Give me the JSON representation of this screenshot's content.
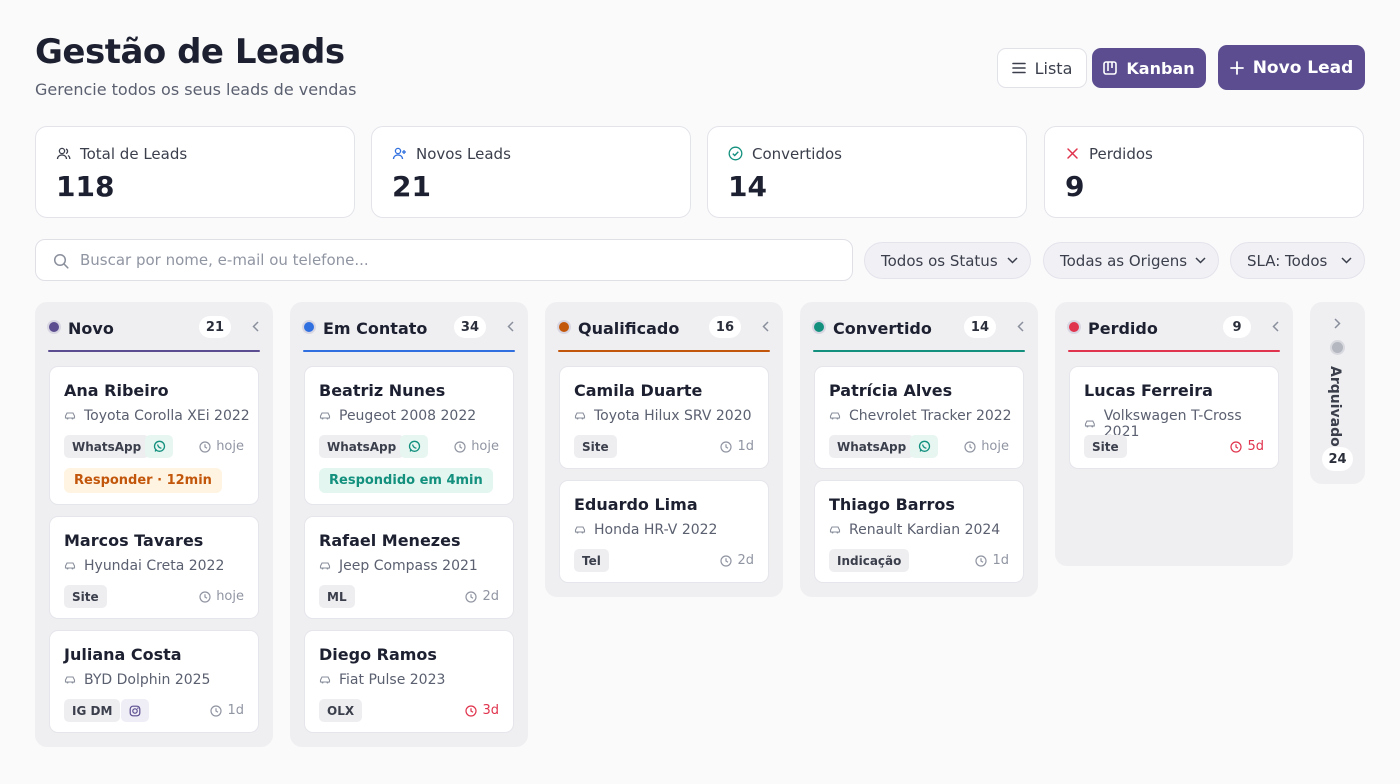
{
  "header": {
    "title": "Gestão de Leads",
    "subtitle": "Gerencie todos os seus leads de vendas",
    "view_list": "Lista",
    "view_kanban": "Kanban",
    "new_lead": "Novo Lead"
  },
  "stats": [
    {
      "label": "Total de Leads",
      "value": "118",
      "icon": "users-icon"
    },
    {
      "label": "Novos Leads",
      "value": "21",
      "icon": "user-plus-icon"
    },
    {
      "label": "Convertidos",
      "value": "14",
      "icon": "check-circle-icon"
    },
    {
      "label": "Perdidos",
      "value": "9",
      "icon": "x-icon"
    }
  ],
  "search": {
    "placeholder": "Buscar por nome, e-mail ou telefone..."
  },
  "filters": {
    "status": "Todos os Status",
    "origin": "Todas as Origens",
    "sla": "SLA: Todos"
  },
  "columns": [
    {
      "name": "Novo",
      "count": "21",
      "color": "#5b4d8f",
      "cards": [
        {
          "name": "Ana Ribeiro",
          "car": "Toyota Corolla XEi 2022",
          "tag": "WhatsApp",
          "icon": "whatsapp",
          "time": "hoje",
          "sla": "Responder · 12min"
        },
        {
          "name": "Marcos Tavares",
          "car": "Hyundai Creta 2022",
          "tag": "Site",
          "time": "hoje"
        },
        {
          "name": "Juliana Costa",
          "car": "BYD Dolphin 2025",
          "tag": "IG DM",
          "icon": "instagram",
          "time": "1d"
        }
      ]
    },
    {
      "name": "Em Contato",
      "count": "34",
      "color": "#2f6fe0",
      "cards": [
        {
          "name": "Beatriz Nunes",
          "car": "Peugeot 2008 2022",
          "tag": "WhatsApp",
          "icon": "whatsapp",
          "time": "hoje",
          "sla": "Respondido em 4min"
        },
        {
          "name": "Rafael Menezes",
          "car": "Jeep Compass 2021",
          "tag": "ML",
          "time": "2d"
        },
        {
          "name": "Diego Ramos",
          "car": "Fiat Pulse 2023",
          "tag": "OLX",
          "time": "3d",
          "late": true
        }
      ]
    },
    {
      "name": "Qualificado",
      "count": "16",
      "color": "#c2570c",
      "cards": [
        {
          "name": "Camila Duarte",
          "car": "Toyota Hilux SRV 2020",
          "tag": "Site",
          "time": "1d"
        },
        {
          "name": "Eduardo Lima",
          "car": "Honda HR-V 2022",
          "tag": "Tel",
          "time": "2d"
        }
      ]
    },
    {
      "name": "Convertido",
      "count": "14",
      "color": "#13907e",
      "cards": [
        {
          "name": "Patrícia Alves",
          "car": "Chevrolet Tracker 2022",
          "tag": "WhatsApp",
          "icon": "whatsapp",
          "time": "hoje"
        },
        {
          "name": "Thiago Barros",
          "car": "Renault Kardian 2024",
          "tag": "Indicação",
          "time": "1d"
        }
      ]
    },
    {
      "name": "Perdido",
      "count": "9",
      "color": "#e0334d",
      "cards": [
        {
          "name": "Lucas Ferreira",
          "car": "Volkswagen T-Cross 2021",
          "tag": "Site",
          "time": "5d",
          "late": true
        }
      ]
    }
  ],
  "archived": {
    "label": "Arquivado",
    "count": "24"
  },
  "colors": {
    "primary": "#5b4d8f",
    "late": "#e0334d",
    "sla_pending_bg": "#fff4e2",
    "sla_pending_text": "#c2570c",
    "sla_done_bg": "#e4f6f0",
    "sla_done_text": "#13907e"
  }
}
